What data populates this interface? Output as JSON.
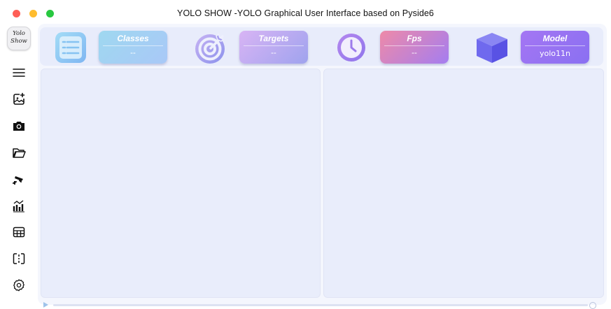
{
  "window": {
    "title": "YOLO SHOW -YOLO Graphical User Interface based on Pyside6",
    "controls": [
      "close",
      "minimize",
      "maximize"
    ]
  },
  "logo": {
    "line1": "Yolo",
    "line2": "Show"
  },
  "sidebar": {
    "items": [
      {
        "name": "menu",
        "icon": "hamburger-menu-icon"
      },
      {
        "name": "image",
        "icon": "add-image-icon"
      },
      {
        "name": "camera",
        "icon": "camera-icon"
      },
      {
        "name": "folder",
        "icon": "folder-icon"
      },
      {
        "name": "webcam",
        "icon": "security-camera-icon"
      },
      {
        "name": "chart",
        "icon": "bar-chart-icon"
      },
      {
        "name": "table",
        "icon": "table-icon"
      },
      {
        "name": "split",
        "icon": "split-view-icon"
      },
      {
        "name": "settings",
        "icon": "gear-icon"
      }
    ]
  },
  "stats": {
    "classes": {
      "label": "Classes",
      "value": "--",
      "icon": "list-icon"
    },
    "targets": {
      "label": "Targets",
      "value": "--",
      "icon": "target-icon"
    },
    "fps": {
      "label": "Fps",
      "value": "--",
      "icon": "clock-icon"
    },
    "model": {
      "label": "Model",
      "value": "yolo11n",
      "icon": "cube-icon"
    }
  },
  "colors": {
    "accent_blue": "#a9c8f7",
    "accent_purple": "#9fa3ee",
    "accent_pink": "#ee8aa8",
    "accent_violet": "#8a70f2",
    "panel_bg": "#e9edfb"
  },
  "progress": {
    "value": 0
  }
}
